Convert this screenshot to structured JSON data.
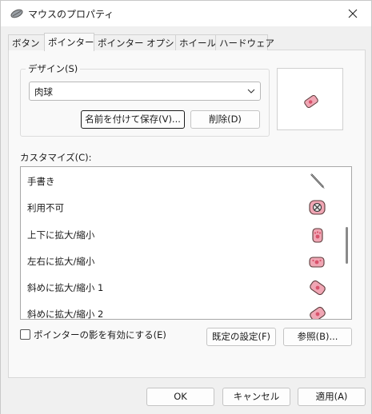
{
  "window": {
    "title": "マウスのプロパティ"
  },
  "tabs": [
    {
      "label": "ボタン"
    },
    {
      "label": "ポインター",
      "active": true
    },
    {
      "label": "ポインター オプション"
    },
    {
      "label": "ホイール"
    },
    {
      "label": "ハードウェア"
    }
  ],
  "scheme": {
    "group_label": "デザイン(S)",
    "selected": "肉球",
    "save_label": "名前を付けて保存(V)...",
    "delete_label": "削除(D)"
  },
  "customize": {
    "label": "カスタマイズ(C):",
    "items": [
      {
        "label": "手書き",
        "icon": "pen-cursor-icon"
      },
      {
        "label": "利用不可",
        "icon": "unavailable-cursor-icon"
      },
      {
        "label": "上下に拡大/縮小",
        "icon": "paw-vertical-resize-icon"
      },
      {
        "label": "左右に拡大/縮小",
        "icon": "paw-horizontal-resize-icon"
      },
      {
        "label": "斜めに拡大/縮小 1",
        "icon": "paw-diagonal-resize-1-icon"
      },
      {
        "label": "斜めに拡大/縮小 2",
        "icon": "paw-diagonal-resize-2-icon"
      }
    ],
    "scroll_position": 0.45
  },
  "shadow": {
    "label": "ポインターの影を有効にする(E)",
    "checked": false
  },
  "buttons": {
    "default_label": "既定の設定(F)",
    "browse_label": "参照(B)..."
  },
  "footer": {
    "ok": "OK",
    "cancel": "キャンセル",
    "apply": "適用(A)"
  },
  "colors": {
    "paw_fill": "#f0a6b4",
    "paw_stroke": "#5a3a3a",
    "accent": "#1a1a1a"
  }
}
